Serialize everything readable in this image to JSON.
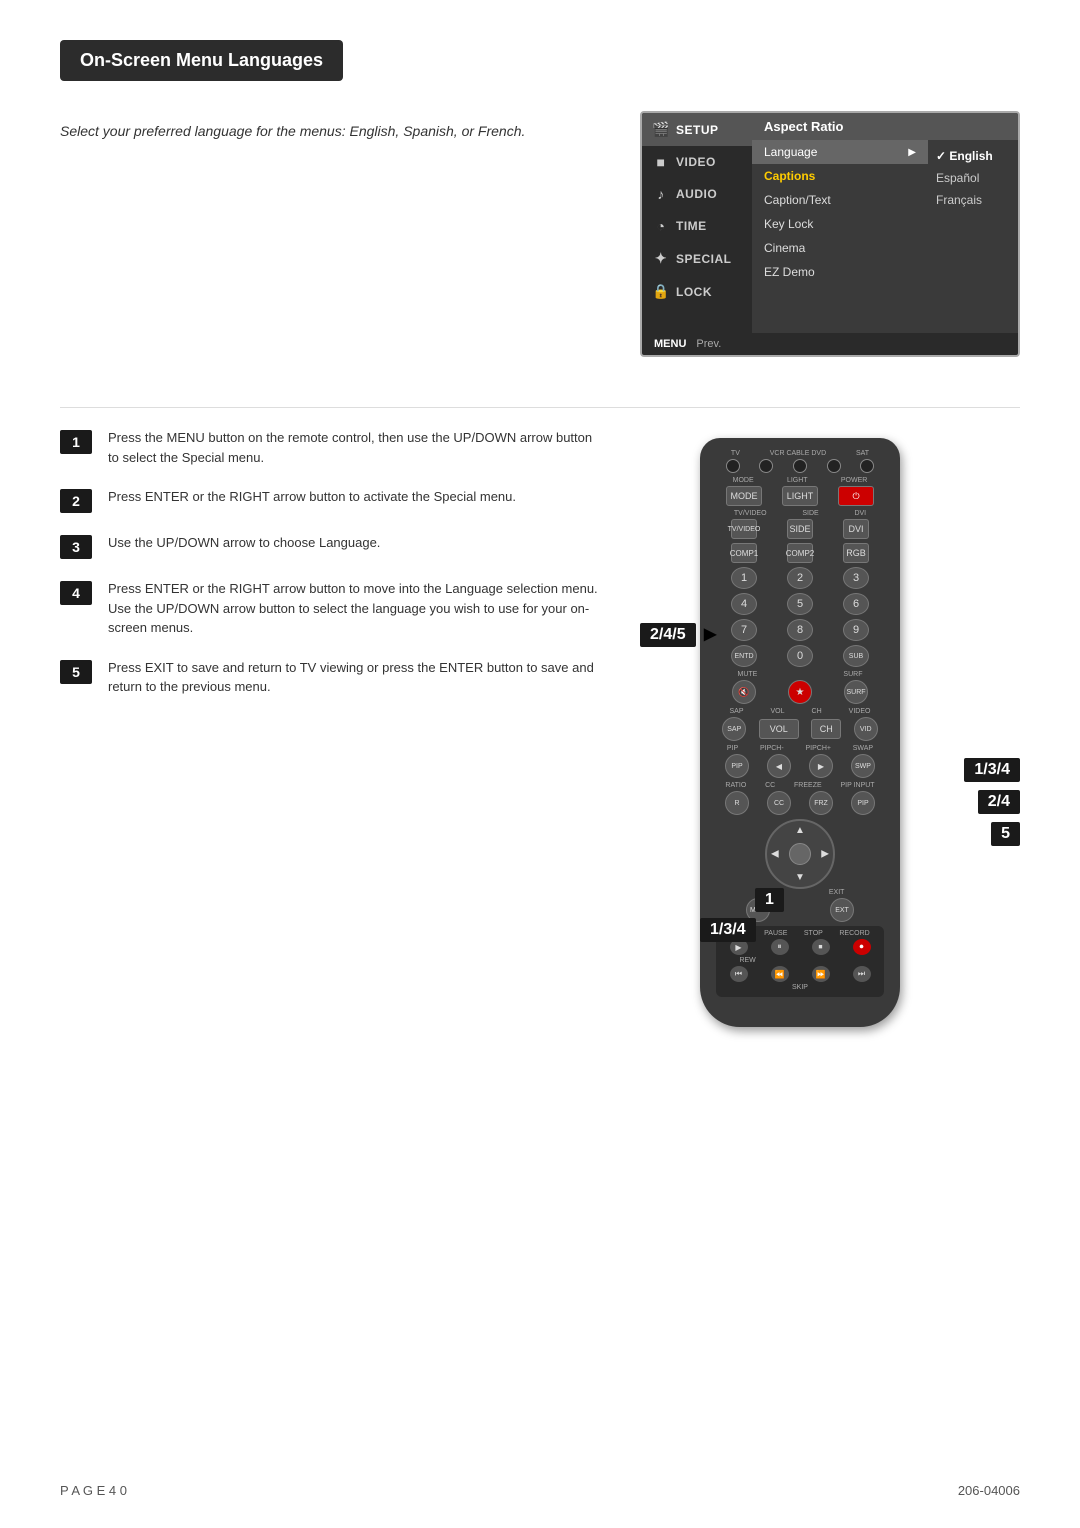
{
  "page": {
    "title": "On-Screen Menu Languages",
    "footer_left": "P A G E  4 0",
    "footer_right": "206-04006"
  },
  "description": {
    "text": "Select your preferred language for the menus: English, Spanish, or French."
  },
  "tv_menu": {
    "items": [
      {
        "icon": "🎬",
        "label": "SETUP",
        "active": true
      },
      {
        "icon": "■",
        "label": "VIDEO",
        "active": false
      },
      {
        "icon": "🔊",
        "label": "AUDIO",
        "active": false
      },
      {
        "icon": "🕐",
        "label": "TIME",
        "active": false
      },
      {
        "icon": "✦",
        "label": "SPECIAL",
        "active": false
      },
      {
        "icon": "🔒",
        "label": "LOCK",
        "active": false
      }
    ],
    "menu_header": "Aspect Ratio",
    "menu_rows": [
      {
        "label": "Language",
        "has_arrow": true,
        "highlight": false,
        "active": true
      },
      {
        "label": "Captions",
        "has_arrow": false,
        "highlight": true
      },
      {
        "label": "Caption/Text",
        "has_arrow": false,
        "highlight": false
      },
      {
        "label": "Key Lock",
        "has_arrow": false,
        "highlight": false
      },
      {
        "label": "Cinema",
        "has_arrow": false,
        "highlight": false
      },
      {
        "label": "EZ Demo",
        "has_arrow": false,
        "highlight": false
      }
    ],
    "languages": [
      {
        "label": "English",
        "selected": true
      },
      {
        "label": "Español",
        "selected": false
      },
      {
        "label": "Français",
        "selected": false
      }
    ],
    "bottom_menu": "MENU",
    "bottom_prev": "Prev."
  },
  "steps": [
    {
      "number": "1",
      "text": "Press the MENU button on the remote control, then use the UP/DOWN arrow button to select the Special menu."
    },
    {
      "number": "2",
      "text": "Press ENTER or the RIGHT arrow button to activate the Special menu."
    },
    {
      "number": "3",
      "text": "Use the UP/DOWN arrow to choose Language."
    },
    {
      "number": "4",
      "text": "Press ENTER or the RIGHT arrow button to move into the Language selection menu. Use the UP/DOWN arrow button to select the language you wish to use for your on-screen menus."
    },
    {
      "number": "5",
      "text": "Press EXIT to save and return to TV viewing or press the ENTER button to save and return to the previous menu."
    }
  ],
  "callout_labels": {
    "label_2_4_5": "2/4/5",
    "label_1_3_4_bottom": "1/3/4",
    "label_1": "1",
    "label_1_3_4_right": "1/3/4",
    "label_2_4_right": "2/4",
    "label_5_right": "5"
  }
}
